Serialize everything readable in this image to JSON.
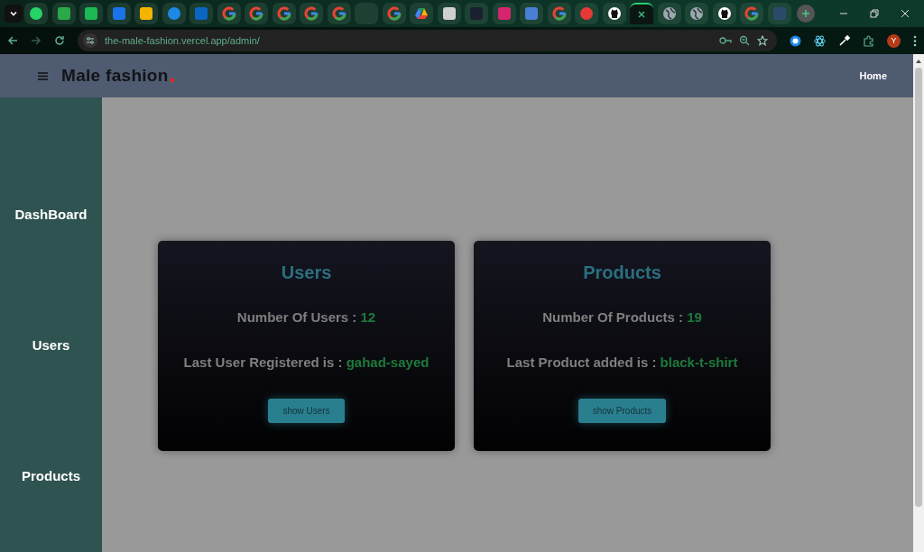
{
  "browser": {
    "tabs": [
      {
        "kind": "circle",
        "color": "#25d366",
        "selected": false
      },
      {
        "kind": "square",
        "color": "#2aa84a",
        "selected": false
      },
      {
        "kind": "square",
        "color": "#1db954",
        "selected": false
      },
      {
        "kind": "square",
        "color": "#1a73e8",
        "selected": false
      },
      {
        "kind": "square",
        "color": "#f4b400",
        "selected": false
      },
      {
        "kind": "circle",
        "color": "#1e88e5",
        "selected": false
      },
      {
        "kind": "square",
        "color": "#0a66c2",
        "selected": false
      },
      {
        "kind": "google",
        "selected": false
      },
      {
        "kind": "google",
        "selected": false
      },
      {
        "kind": "google",
        "selected": false
      },
      {
        "kind": "google",
        "selected": false
      },
      {
        "kind": "google",
        "selected": false
      },
      {
        "kind": "blank",
        "selected": false
      },
      {
        "kind": "google",
        "selected": false
      },
      {
        "kind": "drive",
        "selected": false
      },
      {
        "kind": "square",
        "color": "#d0d0d0",
        "selected": false
      },
      {
        "kind": "square",
        "color": "#1b2030",
        "selected": false
      },
      {
        "kind": "square",
        "color": "#d6246e",
        "selected": false
      },
      {
        "kind": "square",
        "color": "#4a7fd6",
        "selected": false
      },
      {
        "kind": "google",
        "selected": false
      },
      {
        "kind": "circle",
        "color": "#e53935",
        "selected": false
      },
      {
        "kind": "github",
        "selected": false
      },
      {
        "kind": "blank",
        "selected": true
      },
      {
        "kind": "globe",
        "selected": false
      },
      {
        "kind": "globe",
        "selected": false
      },
      {
        "kind": "github",
        "selected": false
      },
      {
        "kind": "google",
        "selected": false
      },
      {
        "kind": "square",
        "color": "#2b4a6a",
        "selected": false
      }
    ],
    "url": "the-male-fashion.vercel.app/admin/",
    "profile_letter": "Y"
  },
  "header": {
    "logo": "Male fashion",
    "nav_link": "Home"
  },
  "sidebar": {
    "items": [
      "DashBoard",
      "Users",
      "Products"
    ]
  },
  "cards": [
    {
      "title": "Users",
      "count_label": "Number Of Users : ",
      "count": "12",
      "last_label": "Last User Registered is : ",
      "last": "gahad-sayed",
      "button": "show Users"
    },
    {
      "title": "Products",
      "count_label": "Number Of Products : ",
      "count": "19",
      "last_label": "Last Product added is : ",
      "last": "black-t-shirt",
      "button": "show Products"
    }
  ]
}
